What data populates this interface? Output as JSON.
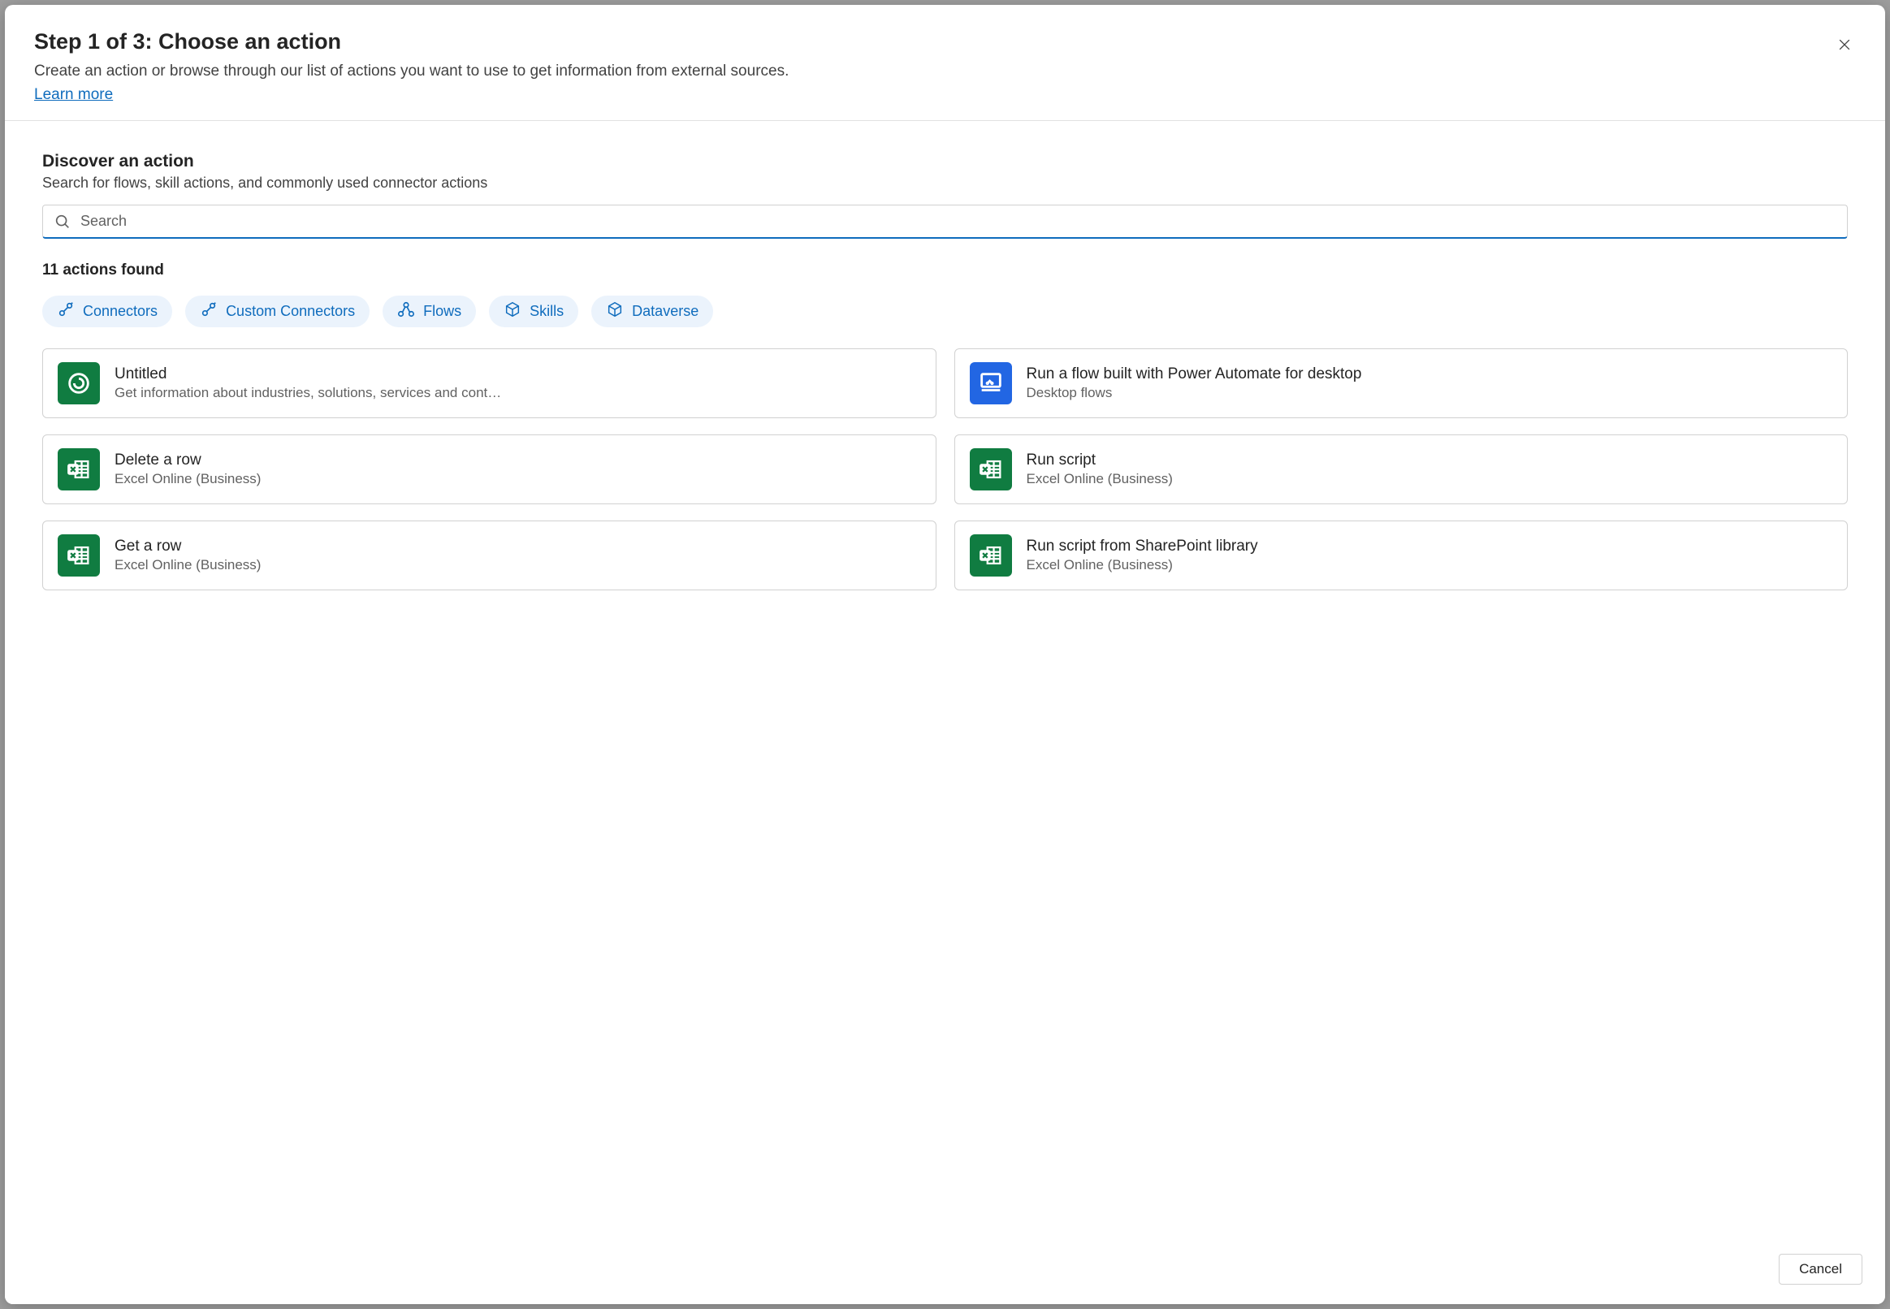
{
  "header": {
    "title": "Step 1 of 3: Choose an action",
    "description": "Create an action or browse through our list of actions you want to use to get information from external sources.",
    "learn_more": "Learn more"
  },
  "discover": {
    "title": "Discover an action",
    "description": "Search for flows, skill actions, and commonly used connector actions"
  },
  "search": {
    "placeholder": "Search",
    "value": ""
  },
  "results": {
    "found_label": "11 actions found"
  },
  "filters": [
    {
      "label": "Connectors",
      "icon": "plug"
    },
    {
      "label": "Custom Connectors",
      "icon": "plug"
    },
    {
      "label": "Flows",
      "icon": "flow"
    },
    {
      "label": "Skills",
      "icon": "cube"
    },
    {
      "label": "Dataverse",
      "icon": "cube"
    }
  ],
  "actions": [
    {
      "title": "Untitled",
      "subtitle": "Get information about industries, solutions, services and cont…",
      "icon": "swirl",
      "color": "green"
    },
    {
      "title": "Run a flow built with Power Automate for desktop",
      "subtitle": "Desktop flows",
      "icon": "monitor",
      "color": "blue"
    },
    {
      "title": "Delete a row",
      "subtitle": "Excel Online (Business)",
      "icon": "excel",
      "color": "green"
    },
    {
      "title": "Run script",
      "subtitle": "Excel Online (Business)",
      "icon": "excel",
      "color": "green"
    },
    {
      "title": "Get a row",
      "subtitle": "Excel Online (Business)",
      "icon": "excel",
      "color": "green"
    },
    {
      "title": "Run script from SharePoint library",
      "subtitle": "Excel Online (Business)",
      "icon": "excel",
      "color": "green"
    }
  ],
  "footer": {
    "cancel": "Cancel"
  }
}
